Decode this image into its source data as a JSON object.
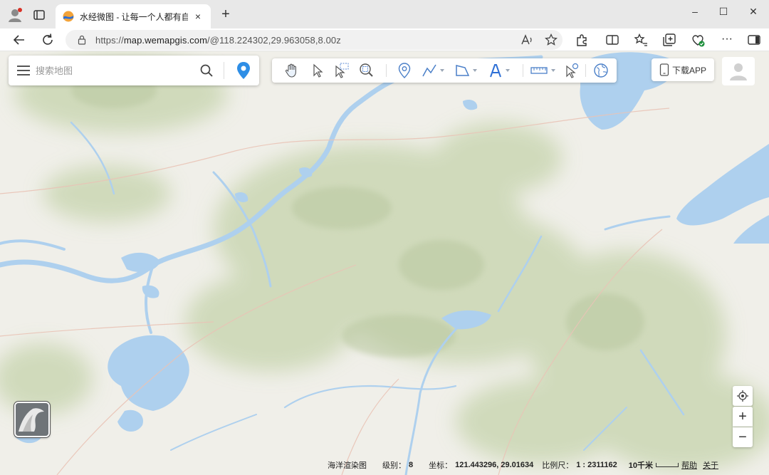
{
  "browser": {
    "tab_title": "水经微图 - 让每一个人都有自己的",
    "tab_close": "×",
    "new_tab": "+",
    "url_prefix": "https://",
    "url_host": "map.wemapgis.com",
    "url_path": "/@118.224302,29.963058,8.00z",
    "window_controls": [
      "–",
      "☐",
      "✕"
    ]
  },
  "map_ui": {
    "search_placeholder": "搜索地图",
    "download_app": "下载APP",
    "tools": [
      "hand-icon",
      "pointer-icon",
      "select-box-icon",
      "zoom-area-icon",
      "pin-icon",
      "polyline-icon",
      "polygon-icon",
      "text-icon",
      "ruler-icon",
      "identify-icon",
      "globe-icon"
    ],
    "zoom_in": "+",
    "zoom_out": "−"
  },
  "status": {
    "layer_name": "海洋渲染图",
    "level_label": "级别：",
    "level_value": "8",
    "coord_label": "坐标：",
    "coord_value": "121.443296, 29.01634",
    "scale_label": "比例尺：",
    "scale_value": "1 : 2311162",
    "scale_bar_label": "10千米",
    "help": "帮助",
    "about": "关于"
  },
  "colors": {
    "water": "#aed0ee",
    "land": "#f0efe9",
    "terrain": "#cbd7b4",
    "accent_pin": "#2e8ee6"
  }
}
